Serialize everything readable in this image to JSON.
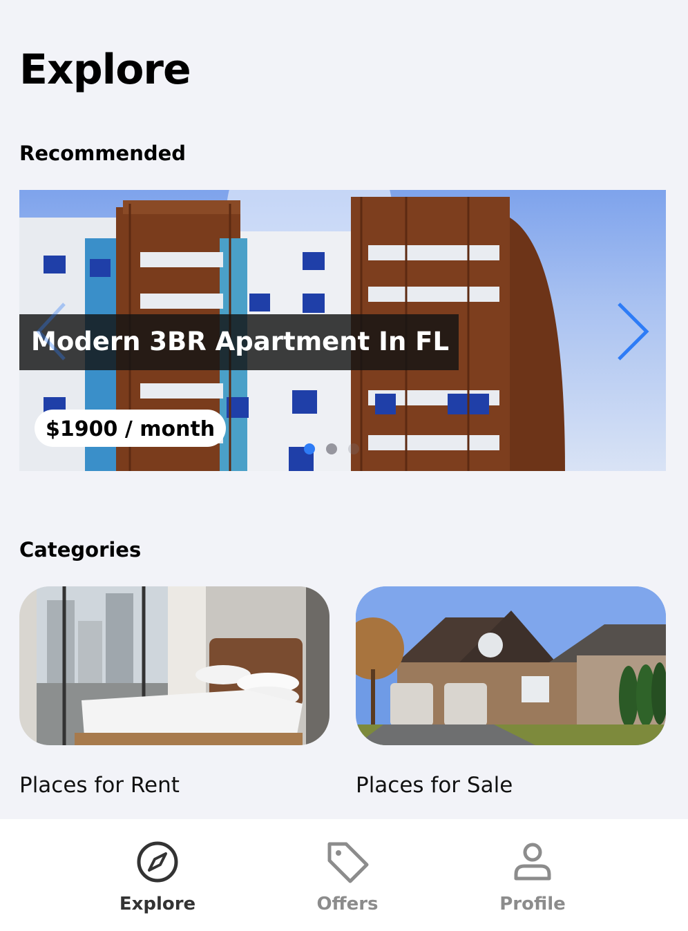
{
  "header": {
    "title": "Explore"
  },
  "recommended": {
    "section_title": "Recommended",
    "slide": {
      "title": "Modern 3BR Apartment In FL",
      "price": "$1900 / month"
    },
    "slide_count": 3,
    "active_slide": 1
  },
  "categories": {
    "section_title": "Categories",
    "items": [
      {
        "label": "Places for Rent"
      },
      {
        "label": "Places for Sale"
      }
    ]
  },
  "nav": {
    "items": [
      {
        "label": "Explore",
        "icon": "compass-icon",
        "active": true
      },
      {
        "label": "Offers",
        "icon": "tag-icon",
        "active": false
      },
      {
        "label": "Profile",
        "icon": "user-icon",
        "active": false
      }
    ]
  },
  "colors": {
    "background": "#f2f3f8",
    "accent": "#2e7cf6",
    "nav_active": "#333333",
    "nav_inactive": "#8c8c8c"
  }
}
